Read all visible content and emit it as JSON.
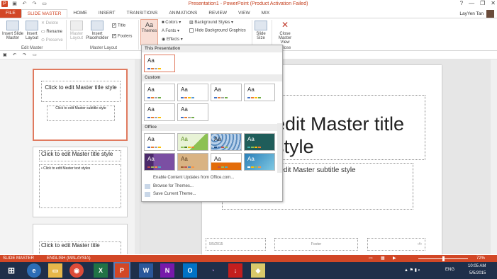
{
  "window": {
    "title": "Presentation1 - PowerPoint (Product Activation Failed)",
    "help": "?",
    "minimize": "—",
    "restore": "❐",
    "close": "✕"
  },
  "user": {
    "name": "LayYen Tan"
  },
  "tabs": [
    "FILE",
    "SLIDE MASTER",
    "HOME",
    "INSERT",
    "TRANSITIONS",
    "ANIMATIONS",
    "REVIEW",
    "VIEW",
    "MIX"
  ],
  "ribbon": {
    "insert_slide_master": "Insert Slide Master",
    "insert_layout": "Insert Layout",
    "delete": "Delete",
    "rename": "Rename",
    "preserve": "Preserve",
    "group_edit_master": "Edit Master",
    "master_layout": "Master Layout",
    "insert_placeholder": "Insert Placeholder",
    "title_chk": "Title",
    "footers_chk": "Footers",
    "group_master_layout": "Master Layout",
    "themes": "Themes",
    "colors": "Colors",
    "fonts": "Fonts",
    "effects": "Effects",
    "background_styles": "Background Styles",
    "hide_bg": "Hide Background Graphics",
    "slide_size": "Slide Size",
    "close_master": "Close Master View",
    "group_close": "Close"
  },
  "dropdown": {
    "this_presentation": "This Presentation",
    "custom": "Custom",
    "office": "Office",
    "enable_updates": "Enable Content Updates from Office.com...",
    "browse": "Browse for Themes...",
    "save": "Save Current Theme...",
    "aa": "Aa"
  },
  "thumbs": {
    "t1_title": "Click to edit Master title style",
    "t1_sub": "Click to edit Master subtitle style",
    "t2_title": "Click to edit Master title style",
    "t2_body": "• Click to edit Master text styles",
    "t3_title": "Click to edit Master title"
  },
  "slide": {
    "title": "edit Master title style",
    "subtitle": "o edit Master subtitle style",
    "date": "5/5/2015",
    "footer": "Footer",
    "num": "‹#›"
  },
  "status": {
    "mode": "SLIDE MASTER",
    "lang": "ENGLISH (MALAYSIA)",
    "zoom": "72%"
  },
  "taskbar": {
    "lang": "ENG",
    "time": "10:05 AM",
    "date": "5/5/2015"
  }
}
